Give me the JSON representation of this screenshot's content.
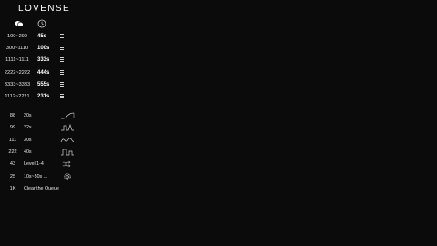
{
  "app": {
    "logo": "LOVENSE"
  },
  "header": {
    "left_icon": "tip-coins-icon",
    "right_icon": "timer-icon"
  },
  "tip_levels": [
    {
      "range": "100~299",
      "duration": "45s",
      "icon": "drag-handle-icon"
    },
    {
      "range": "300~1110",
      "duration": "100s",
      "icon": "drag-handle-icon"
    },
    {
      "range": "1111~1111",
      "duration": "333s",
      "icon": "drag-handle-icon"
    },
    {
      "range": "2222~2222",
      "duration": "444s",
      "icon": "drag-handle-icon"
    },
    {
      "range": "3333~3333",
      "duration": "555s",
      "icon": "drag-handle-icon"
    },
    {
      "range": "1112~2221",
      "duration": "231s",
      "icon": "drag-handle-icon"
    }
  ],
  "special_commands": [
    {
      "amount": "88",
      "value": "20s",
      "icon": "pattern-wave-icon"
    },
    {
      "amount": "99",
      "value": "22s",
      "icon": "pattern-pulse-icon"
    },
    {
      "amount": "111",
      "value": "30s",
      "icon": "pattern-earthquake-icon"
    },
    {
      "amount": "222",
      "value": "40s",
      "icon": "pattern-fireworks-icon"
    },
    {
      "amount": "43",
      "value": "Level 1-4",
      "icon": "random-shuffle-icon"
    },
    {
      "amount": "25",
      "value": "10s~50s ...",
      "icon": "settings-gear-icon"
    },
    {
      "amount": "1K",
      "value": "Clear the Queue",
      "icon": ""
    }
  ],
  "colors": {
    "background": "#0b0b0b",
    "text": "#ffffff",
    "muted": "#e6e6e6",
    "icon": "#cfcfcf"
  }
}
